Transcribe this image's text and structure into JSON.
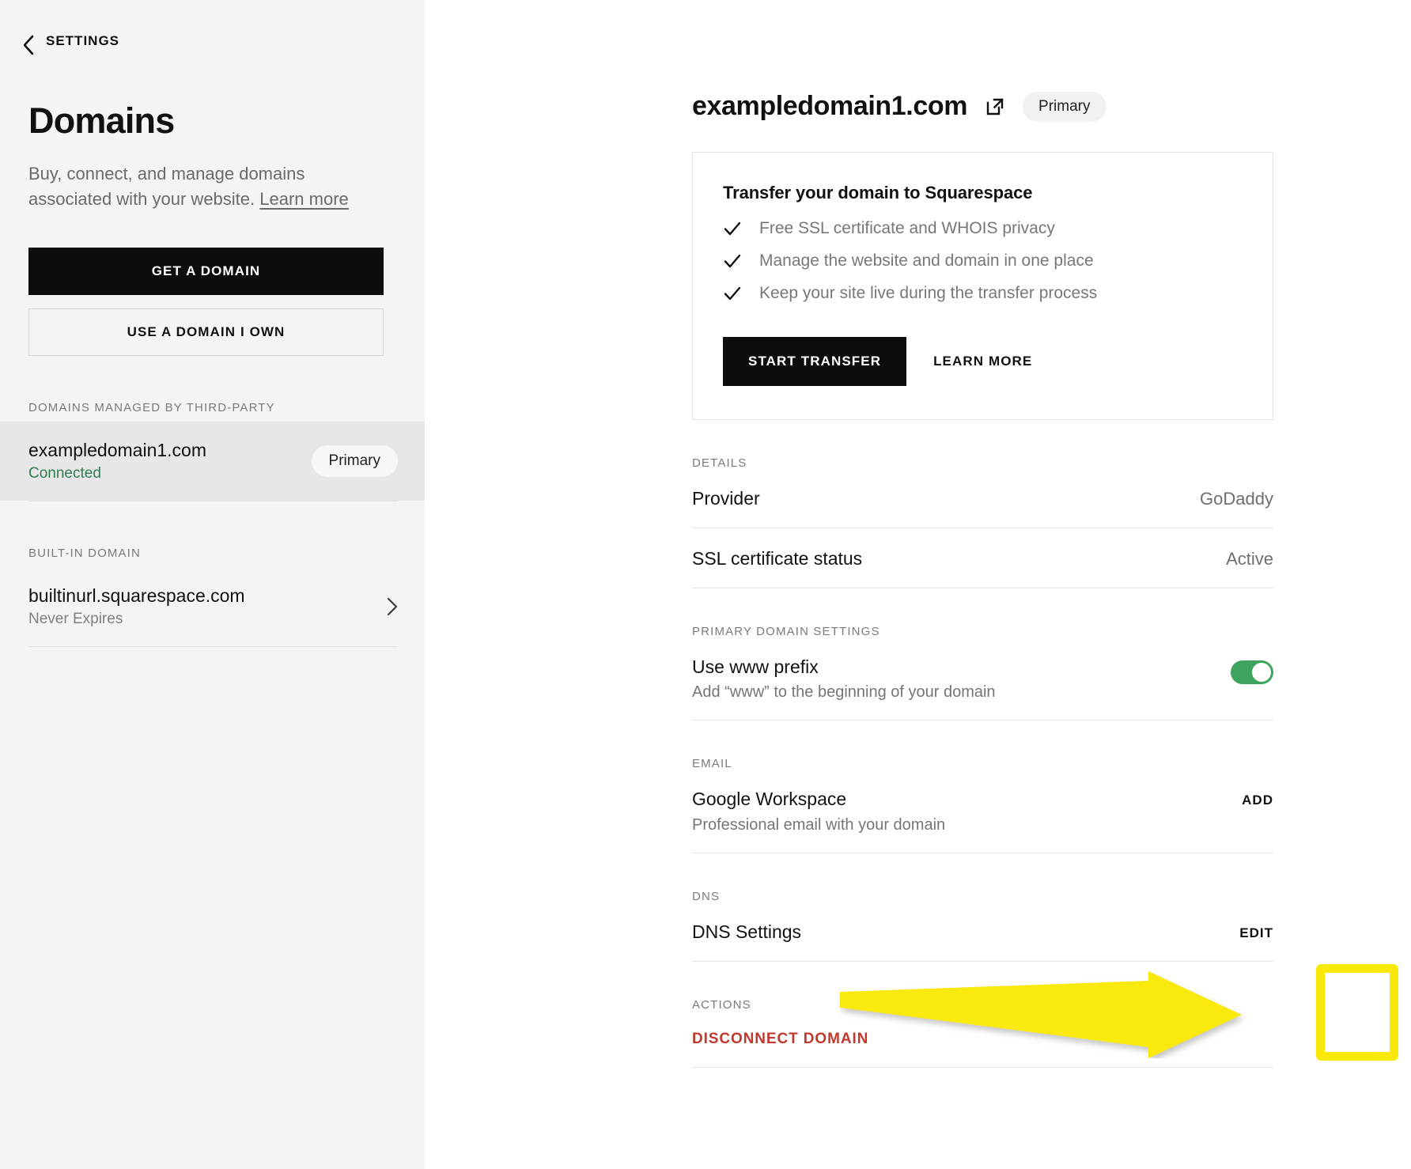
{
  "sidebar": {
    "back_label": "SETTINGS",
    "back_icon": "chevron-left-icon",
    "title": "Domains",
    "description_text": "Buy, connect, and manage domains associated with your website. ",
    "description_link": "Learn more",
    "get_domain_button": "GET A DOMAIN",
    "use_own_domain_button": "USE A DOMAIN I OWN",
    "third_party_label": "DOMAINS MANAGED BY THIRD-PARTY",
    "third_party_domains": [
      {
        "name": "exampledomain1.com",
        "status": "Connected",
        "badge": "Primary"
      }
    ],
    "built_in_label": "BUILT-IN DOMAIN",
    "built_in_domains": [
      {
        "name": "builtinurl.squarespace.com",
        "status": "Never Expires",
        "chevron_icon": "chevron-right-icon"
      }
    ]
  },
  "main": {
    "header": {
      "domain": "exampledomain1.com",
      "external_link_icon": "external-link-icon",
      "badge": "Primary"
    },
    "transfer_card": {
      "title": "Transfer your domain to Squarespace",
      "benefits": [
        "Free SSL certificate and WHOIS privacy",
        "Manage the website and domain in one place",
        "Keep your site live during the transfer process"
      ],
      "check_icon": "check-icon",
      "start_button": "START TRANSFER",
      "learn_more_button": "LEARN MORE"
    },
    "details": {
      "label": "DETAILS",
      "rows": [
        {
          "title": "Provider",
          "value": "GoDaddy"
        },
        {
          "title": "SSL certificate status",
          "value": "Active"
        }
      ]
    },
    "primary_domain_settings": {
      "label": "PRIMARY DOMAIN SETTINGS",
      "row": {
        "title": "Use www prefix",
        "subtitle": "Add “www” to the beginning of your domain",
        "toggle_on": "true"
      }
    },
    "email": {
      "label": "EMAIL",
      "row": {
        "title": "Google Workspace",
        "subtitle": "Professional email with your domain",
        "action": "ADD"
      }
    },
    "dns": {
      "label": "DNS",
      "row": {
        "title": "DNS Settings",
        "action": "EDIT"
      }
    },
    "actions": {
      "label": "ACTIONS",
      "disconnect": "DISCONNECT DOMAIN"
    }
  },
  "annotation": {
    "arrow_color": "#f9e90b",
    "highlight_color": "#f9e90b",
    "target": "EDIT"
  },
  "colors": {
    "sidebar_bg": "#f4f4f4",
    "accent_dark": "#0d0d0d",
    "toggle_green": "#3da35d",
    "connected_green": "#2f7d51",
    "danger_red": "#c0392f"
  }
}
